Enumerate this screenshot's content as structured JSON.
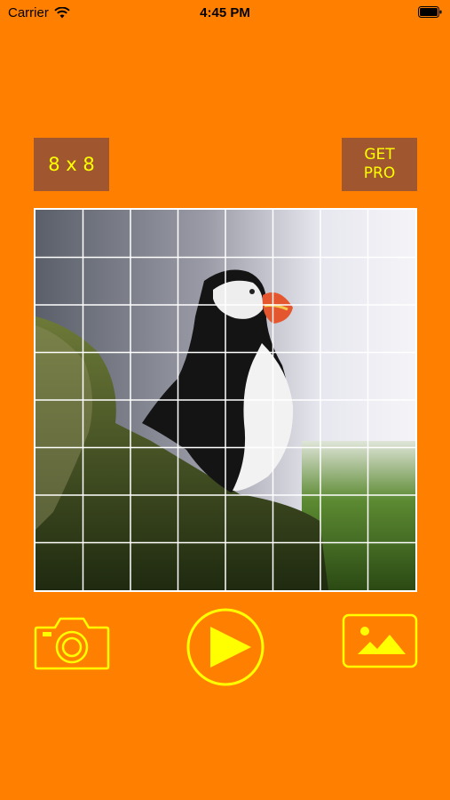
{
  "status_bar": {
    "carrier": "Carrier",
    "time": "4:45 PM"
  },
  "toolbar": {
    "grid_size_label": "8 x 8",
    "get_pro_line1": "GET",
    "get_pro_line2": "PRO"
  },
  "puzzle": {
    "rows": 8,
    "cols": 8,
    "subject": "puffin"
  },
  "bottom_bar": {
    "camera_icon": "camera-icon",
    "play_icon": "play-icon",
    "gallery_icon": "image-icon"
  },
  "colors": {
    "background": "#FF8000",
    "button_bg": "#A0562E",
    "accent": "#FFFF00"
  }
}
